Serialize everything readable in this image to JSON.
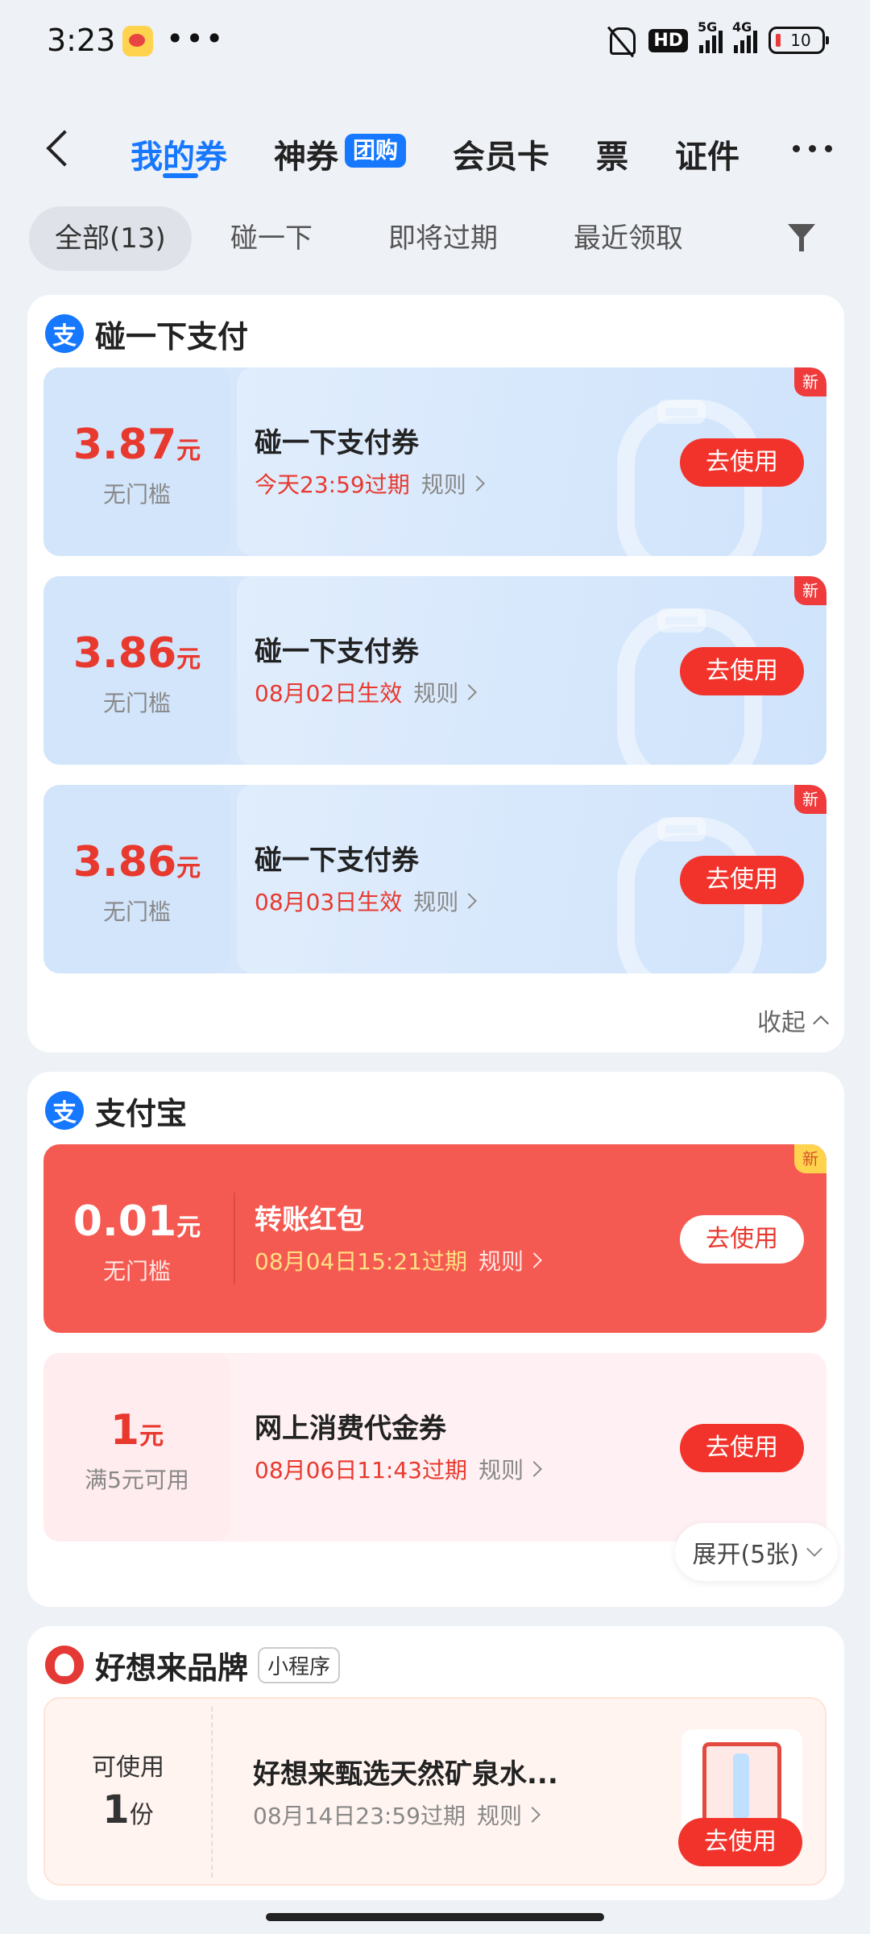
{
  "status": {
    "time": "3:23",
    "dots": "•••",
    "hd": "HD",
    "net5g": "5G",
    "net4g": "4G",
    "battery": "10"
  },
  "header": {
    "tabs": [
      {
        "label": "我的券"
      },
      {
        "label": "神券"
      },
      {
        "label": "会员卡"
      },
      {
        "label": "票"
      },
      {
        "label": "证件"
      }
    ],
    "tuan_badge": "团购"
  },
  "filters": {
    "chips": [
      "全部(13)",
      "碰一下",
      "即将过期",
      "最近领取"
    ]
  },
  "sections": [
    {
      "title": "碰一下支付",
      "icon_glyph": "支",
      "coupons": [
        {
          "amount": "3.87",
          "unit": "元",
          "threshold": "无门槛",
          "name": "碰一下支付券",
          "expiry": "今天23:59过期",
          "rule": "规则",
          "button": "去使用",
          "new_tag": "新"
        },
        {
          "amount": "3.86",
          "unit": "元",
          "threshold": "无门槛",
          "name": "碰一下支付券",
          "expiry": "08月02日生效",
          "rule": "规则",
          "button": "去使用",
          "new_tag": "新"
        },
        {
          "amount": "3.86",
          "unit": "元",
          "threshold": "无门槛",
          "name": "碰一下支付券",
          "expiry": "08月03日生效",
          "rule": "规则",
          "button": "去使用",
          "new_tag": "新"
        }
      ],
      "footer": "收起"
    },
    {
      "title": "支付宝",
      "icon_glyph": "支",
      "coupons": [
        {
          "amount": "0.01",
          "unit": "元",
          "threshold": "无门槛",
          "name": "转账红包",
          "expiry": "08月04日15:21过期",
          "rule": "规则",
          "button": "去使用",
          "new_tag": "新"
        },
        {
          "amount": "1",
          "unit": "元",
          "threshold": "满5元可用",
          "name": "网上消费代金券",
          "expiry": "08月06日11:43过期",
          "rule": "规则",
          "button": "去使用"
        }
      ],
      "footer": "展开(5张)"
    },
    {
      "title": "好想来品牌",
      "tag": "小程序",
      "coupons": [
        {
          "avail_label": "可使用",
          "qty": "1",
          "qty_unit": "份",
          "name": "好想来甄选天然矿泉水...",
          "expiry": "08月14日23:59过期",
          "rule": "规则",
          "button": "去使用"
        }
      ]
    }
  ],
  "colors": {
    "accent": "#1677ff",
    "coupon_red": "#f55a52",
    "button_red": "#f2332b",
    "page_bg": "#eef1f6"
  }
}
